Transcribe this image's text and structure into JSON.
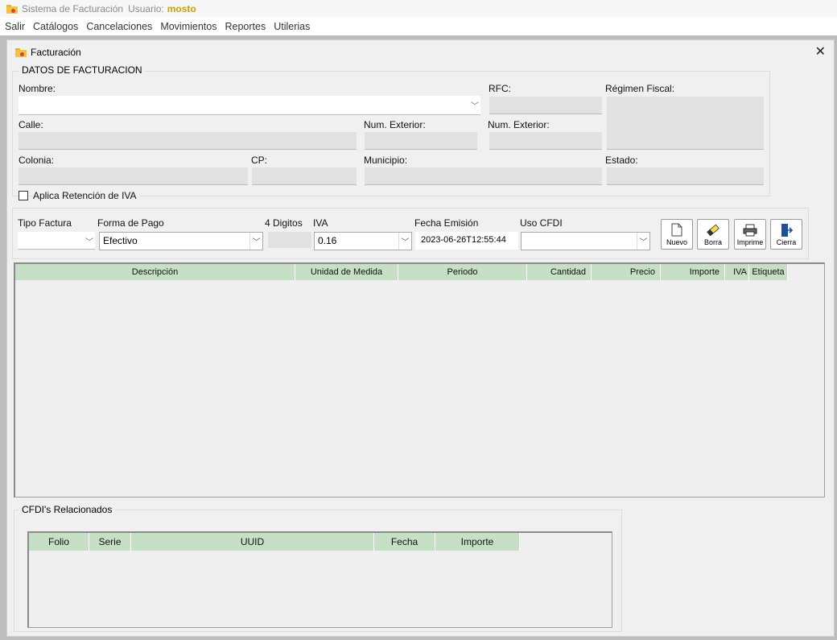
{
  "app": {
    "title": "Sistema de Facturación",
    "user_label": "Usuario:",
    "user_name": "mosto"
  },
  "menu": [
    "Salir",
    "Catálogos",
    "Cancelaciones",
    "Movimientos",
    "Reportes",
    "Utilerias"
  ],
  "window": {
    "title": "Facturación",
    "close": "✕"
  },
  "datos": {
    "legend": "DATOS DE FACTURACION",
    "nombre_label": "Nombre:",
    "rfc_label": "RFC:",
    "regimen_label": "Régimen Fiscal:",
    "calle_label": "Calle:",
    "num_ext_label": "Num. Exterior:",
    "num_ext2_label": "Num. Exterior:",
    "colonia_label": "Colonia:",
    "cp_label": "CP:",
    "municipio_label": "Municipio:",
    "estado_label": "Estado:"
  },
  "retencion": {
    "label": "Aplica Retención de IVA",
    "checked": false
  },
  "factura": {
    "tipo_label": "Tipo Factura",
    "tipo_value": "",
    "forma_pago_label": "Forma de Pago",
    "forma_pago_value": "Efectivo",
    "digitos_label": "4 Digitos",
    "iva_label": "IVA",
    "iva_value": "0.16",
    "fecha_label": "Fecha Emisión",
    "fecha_value": "2023-06-26T12:55:44",
    "uso_label": "Uso CFDI",
    "uso_value": ""
  },
  "buttons": {
    "nuevo": "Nuevo",
    "borra": "Borra",
    "imprime": "Imprime",
    "cierra": "Cierra"
  },
  "items_table": {
    "columns": [
      "Descripción",
      "Unidad de Medida",
      "Periodo",
      "Cantidad",
      "Precio",
      "Importe",
      "IVA",
      "Etiqueta"
    ],
    "rows": []
  },
  "cfdi": {
    "legend": "CFDI's Relacionados",
    "columns": [
      "Folio",
      "Serie",
      "UUID",
      "Fecha",
      "Importe"
    ],
    "rows": []
  },
  "colors": {
    "grid_header": "#c6e0c6",
    "field_disabled": "#e1e1e1",
    "user_name": "#c9a000"
  }
}
